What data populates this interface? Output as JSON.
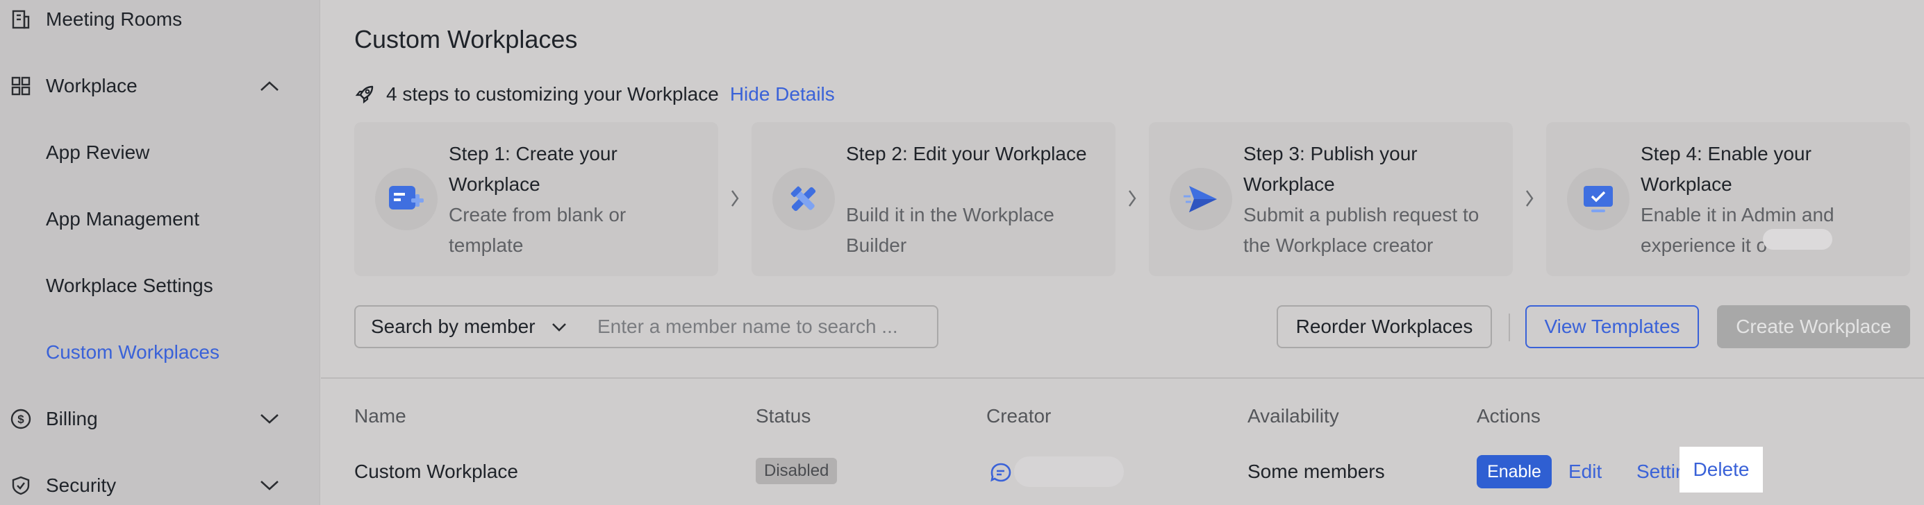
{
  "sidebar": {
    "items": [
      {
        "label": "Meeting Rooms",
        "icon": "building-icon"
      },
      {
        "label": "Workplace",
        "icon": "grid-icon",
        "expanded": true
      },
      {
        "label": "App Review"
      },
      {
        "label": "App Management"
      },
      {
        "label": "Workplace Settings"
      },
      {
        "label": "Custom Workplaces",
        "active": true
      },
      {
        "label": "Billing",
        "icon": "dollar-icon",
        "expanded": false
      },
      {
        "label": "Security",
        "icon": "shield-icon",
        "expanded": false
      }
    ]
  },
  "page": {
    "title": "Custom Workplaces",
    "steps_header": "4 steps to customizing your Workplace",
    "hide_details": "Hide Details"
  },
  "steps": [
    {
      "title": "Step 1: Create your Workplace",
      "desc": "Create from blank or template",
      "icon": "add-app-icon"
    },
    {
      "title": "Step 2: Edit your Workplace",
      "desc": "Build it in the Workplace Builder",
      "icon": "tools-icon"
    },
    {
      "title": "Step 3: Publish your Workplace",
      "desc": "Submit a publish request to the Workplace creator",
      "icon": "send-icon"
    },
    {
      "title": "Step 4: Enable your Workplace",
      "desc": "Enable it in Admin and experience it o",
      "icon": "monitor-check-icon"
    }
  ],
  "toolbar": {
    "search_by": "Search by member",
    "search_placeholder": "Enter a member name to search ...",
    "reorder": "Reorder Workplaces",
    "view_templates": "View Templates",
    "create": "Create Workplace"
  },
  "table": {
    "headers": [
      "Name",
      "Status",
      "Creator",
      "Availability",
      "Actions"
    ],
    "rows": [
      {
        "name": "Custom Workplace",
        "status": "Disabled",
        "availability": "Some members",
        "actions": {
          "enable": "Enable",
          "edit": "Edit",
          "settings": "Settings",
          "delete": "Delete"
        }
      }
    ]
  },
  "colors": {
    "accent": "#3a62d8",
    "enable_button": "#2f5fd2",
    "disabled_button": "#a8a8a8"
  }
}
